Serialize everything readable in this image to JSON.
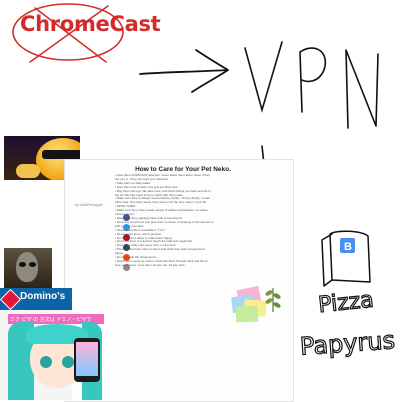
{
  "sketch": {
    "crossed_out_label": "ChromeCast",
    "handwritten_vpn": "VPN",
    "handwritten_checkmark": "✓",
    "handwritten_pizza": "Pizza",
    "handwritten_papyrus": "Papyrus",
    "bitcoin_symbol": "B"
  },
  "article": {
    "title": "How to Care for Your Pet Neko.",
    "author": "by LilahPineapple",
    "lines": [
      "• Give them CONSTANT attention, never leave them alone. Even if they",
      "  are you in. They just want your attention.",
      "• Take them on daily walks.",
      "• Give them lots of belly rubs and pet their ears.",
      "• Buy them cat toys, like fake mice, and throw things you want around in",
      "  the air that they have to try to catch with their paws.",
      "• Make sure they're always surrounded by family - find by family, I mean",
      "  other cats. Not other nekos, they want to be the only neko in your life.",
      "• SPOIL THEM.",
      "• Make sure they have a wide variety of collars and leashes, so rabies",
      "  must be avoid.",
      "• Make sure they (always) have milk or tea around.",
      "• Get them an art bed, feel give them a choice of sleeping in the cat bed or",
      "  with you, or your bed.",
      "• Never leave them unsatisfied. \"(ᵔᴥᵔ)\"",
      "• Never leave them, just in general.",
      "• Do whatever it takes to make them happy.",
      "• Don't put them in a kennel, they'll feel sad and neglected.",
      "• Give them daily cuts every hour, on the hour.",
      "• They are the boss, listen to them and what they want to keep them",
      "  happy.",
      "• Do not break the string spoon.",
      "• Nekos are moody by nature. Deal with them through thick and thin &",
      "  love you forever. Love them forever too. It's key tube."
    ]
  },
  "ad": {
    "brand": "Domino's",
    "tagline": "ミク ピザ の 注文は ドミノ・ピザで"
  },
  "colors": {
    "red_ink": "#d42a2a",
    "pen_ink": "#111111",
    "dominos_blue": "#0b64a6",
    "miku_teal": "#37c6c0"
  }
}
